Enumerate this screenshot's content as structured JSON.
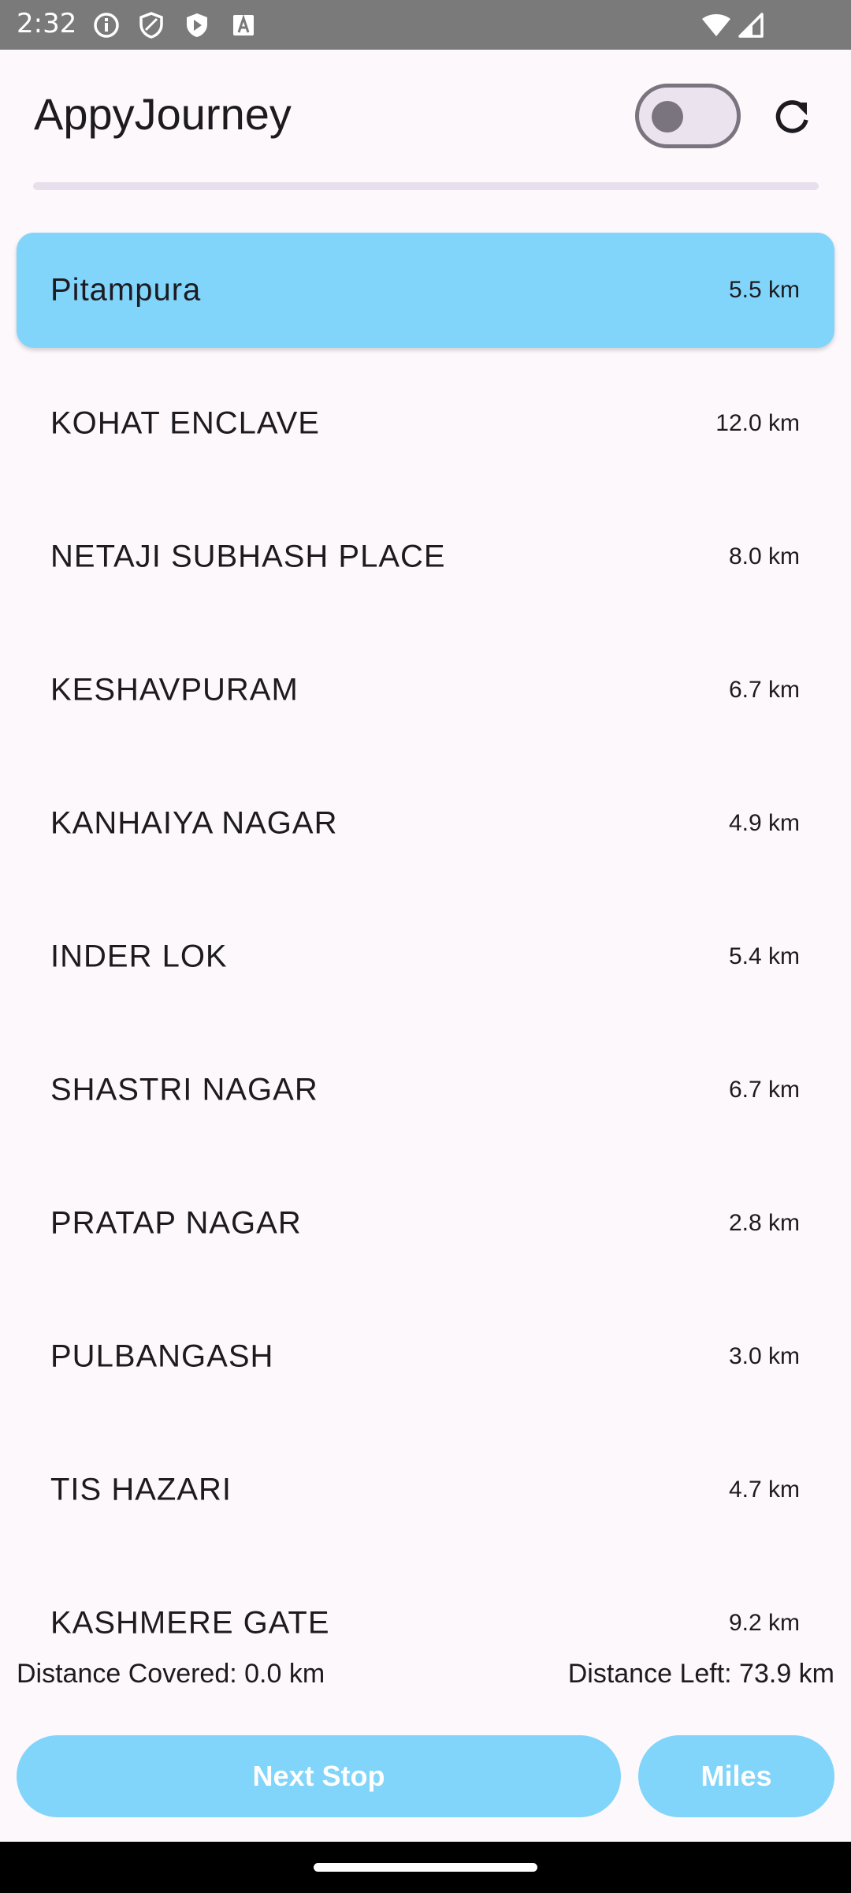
{
  "status_bar": {
    "time": "2:32",
    "left_icons": [
      "info-icon",
      "shield-icon",
      "play-shield-icon",
      "font-a-icon"
    ],
    "right_icons": [
      "wifi-icon",
      "cellular-signal-icon"
    ]
  },
  "app_bar": {
    "title": "AppyJourney",
    "toggle_on": false,
    "refresh_icon": "refresh-icon"
  },
  "progress": 0,
  "stops": [
    {
      "name": "Pitampura",
      "distance": "5.5 km",
      "selected": true
    },
    {
      "name": "KOHAT ENCLAVE",
      "distance": "12.0 km",
      "selected": false
    },
    {
      "name": "NETAJI SUBHASH PLACE",
      "distance": "8.0 km",
      "selected": false
    },
    {
      "name": "KESHAVPURAM",
      "distance": "6.7 km",
      "selected": false
    },
    {
      "name": "KANHAIYA NAGAR",
      "distance": "4.9 km",
      "selected": false
    },
    {
      "name": "INDER LOK",
      "distance": "5.4 km",
      "selected": false
    },
    {
      "name": "SHASTRI NAGAR",
      "distance": "6.7 km",
      "selected": false
    },
    {
      "name": "PRATAP NAGAR",
      "distance": "2.8 km",
      "selected": false
    },
    {
      "name": "PULBANGASH",
      "distance": "3.0 km",
      "selected": false
    },
    {
      "name": "TIS HAZARI",
      "distance": "4.7 km",
      "selected": false
    },
    {
      "name": "KASHMERE GATE",
      "distance": "9.2 km",
      "selected": false
    }
  ],
  "footer": {
    "distance_covered": "Distance Covered: 0.0 km",
    "distance_left": "Distance Left: 73.9 km",
    "next_stop_label": "Next Stop",
    "miles_label": "Miles"
  },
  "colors": {
    "accent": "#81d4fa",
    "background": "#fdf8fc",
    "text": "#1d1b20"
  }
}
